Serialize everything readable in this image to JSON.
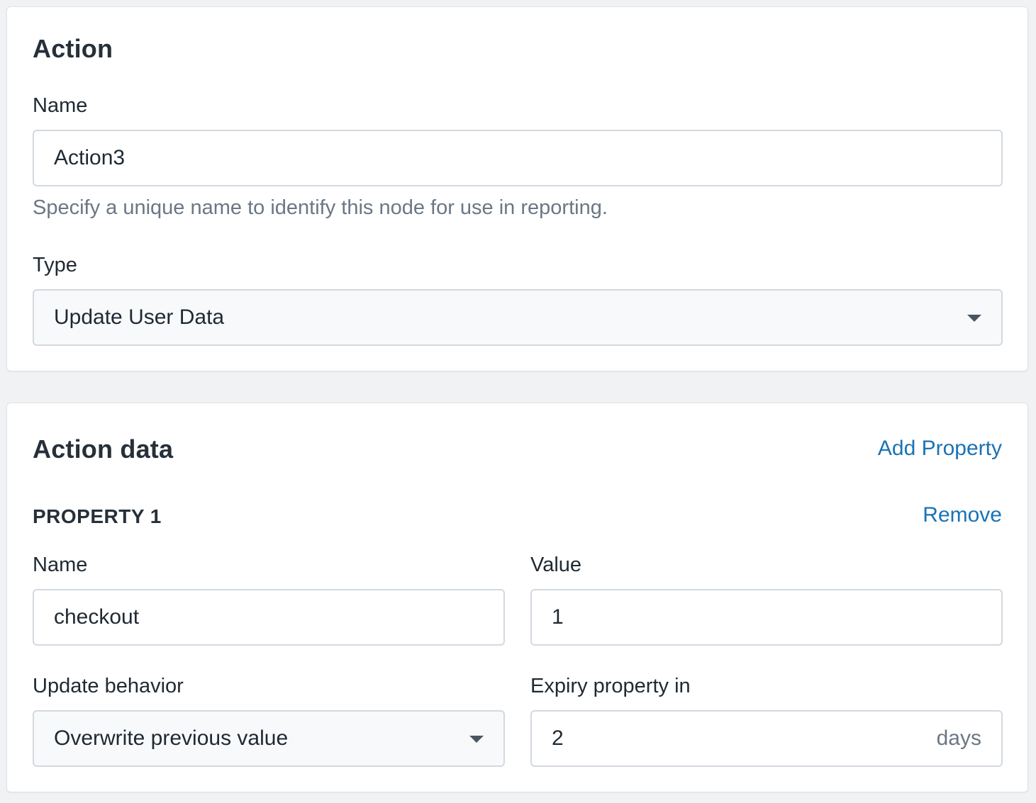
{
  "action_card": {
    "title": "Action",
    "name_label": "Name",
    "name_value": "Action3",
    "name_help": "Specify a unique name to identify this node for use in reporting.",
    "type_label": "Type",
    "type_value": "Update User Data"
  },
  "action_data_card": {
    "title": "Action data",
    "add_property_label": "Add Property",
    "property": {
      "heading": "PROPERTY 1",
      "remove_label": "Remove",
      "name_label": "Name",
      "name_value": "checkout",
      "value_label": "Value",
      "value_value": "1",
      "update_behavior_label": "Update behavior",
      "update_behavior_value": "Overwrite previous value",
      "expiry_label": "Expiry property in",
      "expiry_value": "2",
      "expiry_unit": "days"
    }
  },
  "colors": {
    "background": "#f1f2f4",
    "link": "#1a73b5",
    "help_text": "#6b7785",
    "input_border": "#d3d9e0"
  }
}
